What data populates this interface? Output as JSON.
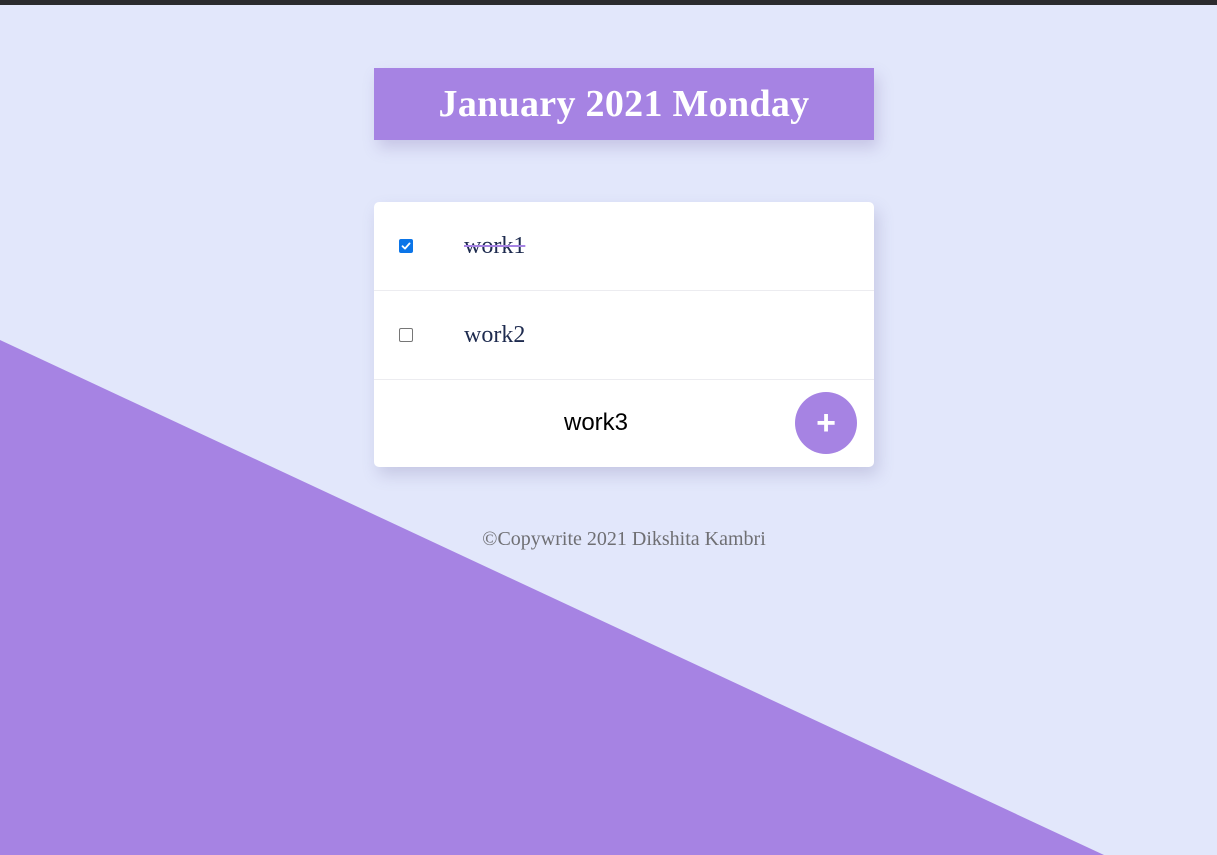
{
  "header": {
    "title": "January 2021 Monday"
  },
  "todos": [
    {
      "label": "work1",
      "checked": true
    },
    {
      "label": "work2",
      "checked": false
    }
  ],
  "new_item": {
    "value": "work3",
    "add_label": "+"
  },
  "footer": {
    "text": "©Copywrite 2021 Dikshita Kambri"
  },
  "colors": {
    "background": "#E2E7FB",
    "accent": "#A683E3",
    "checkbox_checked": "#0B75E8"
  }
}
